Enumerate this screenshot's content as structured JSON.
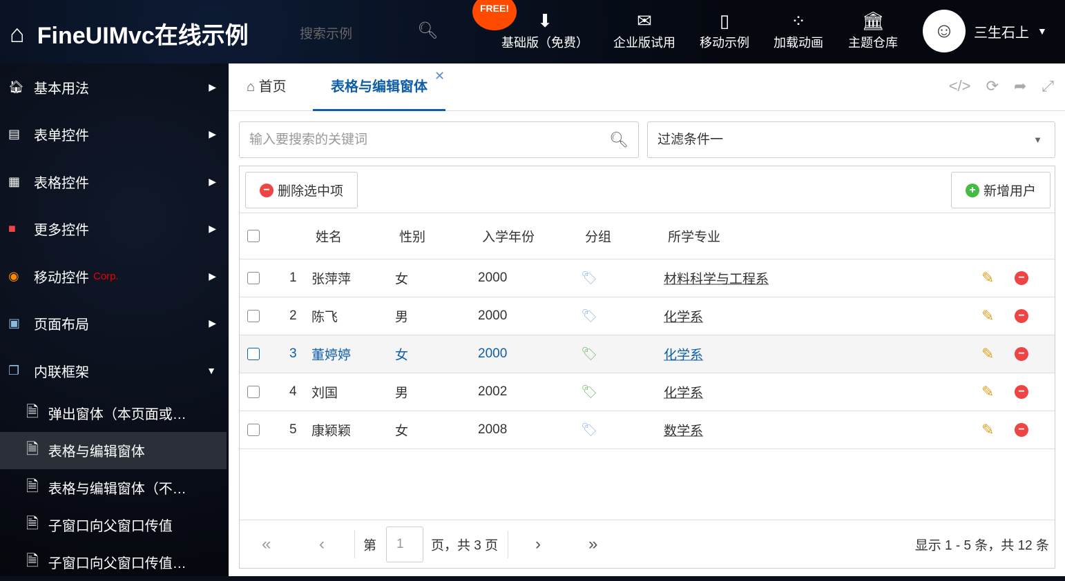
{
  "header": {
    "title": "FineUIMvc在线示例",
    "search_placeholder": "搜索示例",
    "free_badge": "FREE!",
    "nav": [
      {
        "label": "基础版（免费）",
        "icon": "download-icon"
      },
      {
        "label": "企业版试用",
        "icon": "envelope-icon"
      },
      {
        "label": "移动示例",
        "icon": "mobile-icon"
      },
      {
        "label": "加载动画",
        "icon": "spinner-icon"
      },
      {
        "label": "主题仓库",
        "icon": "bank-icon"
      }
    ],
    "user": "三生石上"
  },
  "sidebar": {
    "items": [
      {
        "label": "基本用法"
      },
      {
        "label": "表单控件"
      },
      {
        "label": "表格控件"
      },
      {
        "label": "更多控件"
      },
      {
        "label": "移动控件",
        "badge": "Corp."
      },
      {
        "label": "页面布局"
      },
      {
        "label": "内联框架"
      }
    ],
    "subitems": [
      {
        "label": "弹出窗体（本页面或…"
      },
      {
        "label": "表格与编辑窗体"
      },
      {
        "label": "表格与编辑窗体（不…"
      },
      {
        "label": "子窗口向父窗口传值"
      },
      {
        "label": "子窗口向父窗口传值…"
      }
    ]
  },
  "tabs": [
    {
      "label": "首页"
    },
    {
      "label": "表格与编辑窗体"
    }
  ],
  "filters": {
    "search_placeholder": "输入要搜索的关键词",
    "select_value": "过滤条件一"
  },
  "toolbar": {
    "delete": "删除选中项",
    "add": "新增用户"
  },
  "columns": [
    "姓名",
    "性别",
    "入学年份",
    "分组",
    "所学专业"
  ],
  "rows": [
    {
      "no": "1",
      "name": "张萍萍",
      "gender": "女",
      "year": "2000",
      "major": "材料科学与工程系"
    },
    {
      "no": "2",
      "name": "陈飞",
      "gender": "男",
      "year": "2000",
      "major": "化学系"
    },
    {
      "no": "3",
      "name": "董婷婷",
      "gender": "女",
      "year": "2000",
      "major": "化学系"
    },
    {
      "no": "4",
      "name": "刘国",
      "gender": "男",
      "year": "2002",
      "major": "化学系"
    },
    {
      "no": "5",
      "name": "康颖颖",
      "gender": "女",
      "year": "2008",
      "major": "数学系"
    }
  ],
  "pager": {
    "prefix": "第",
    "page": "1",
    "suffix": "页，共 3 页",
    "summary": "显示 1 - 5 条，共 12 条"
  }
}
